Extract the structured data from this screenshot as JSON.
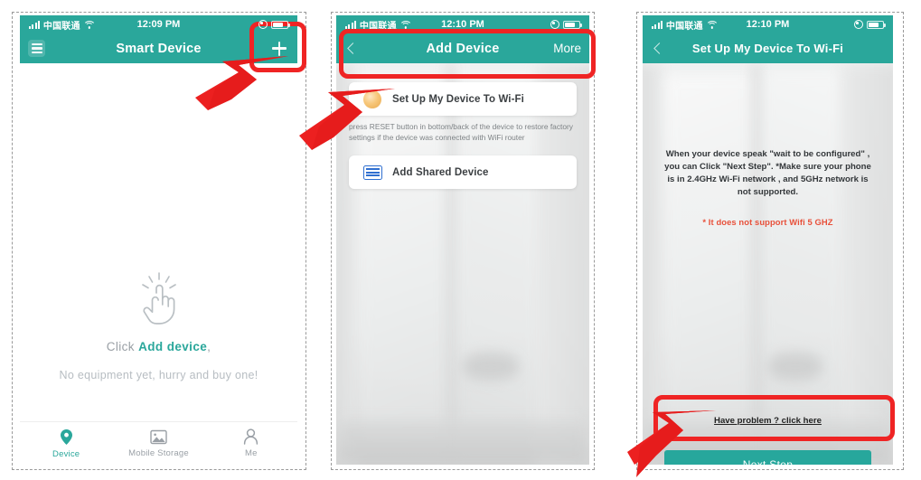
{
  "theme": {
    "teal": "#2aa79b",
    "teal_button": "#27a79c",
    "red_annotation": "#ef2424",
    "warn_red": "#e8503a",
    "muted_text": "#9aa0a6"
  },
  "screens": [
    {
      "id": "smart-device-list",
      "status_bar": {
        "carrier": "中国联通",
        "time": "12:09 PM",
        "signal_icon": "signal-bars-icon",
        "wifi_icon": "wifi-icon",
        "battery_icon": "battery-icon",
        "location_icon": "location-icon"
      },
      "nav": {
        "menu_icon": "hamburger-menu-icon",
        "title": "Smart Device",
        "add_icon": "plus-icon"
      },
      "empty_state": {
        "hand_icon": "tap-hand-icon",
        "title_prefix": "Click ",
        "title_highlight": "Add device",
        "title_suffix": ",",
        "subtitle": "No equipment yet, hurry and buy one!"
      },
      "tabbar": [
        {
          "label": "Device",
          "icon": "location-pin-icon",
          "active": true
        },
        {
          "label": "Mobile Storage",
          "icon": "photo-icon",
          "active": false
        },
        {
          "label": "Me",
          "icon": "person-icon",
          "active": false
        }
      ]
    },
    {
      "id": "add-device",
      "status_bar": {
        "carrier": "中国联通",
        "time": "12:10 PM",
        "signal_icon": "signal-bars-icon",
        "wifi_icon": "wifi-icon",
        "battery_icon": "battery-icon",
        "location_icon": "location-icon"
      },
      "nav": {
        "back_icon": "chevron-left-icon",
        "title": "Add Device",
        "more_label": "More"
      },
      "options": [
        {
          "label": "Set Up My Device To Wi-Fi",
          "icon": "sun-ripple-icon"
        },
        {
          "label": "Add Shared Device",
          "icon": "qr-code-icon"
        }
      ],
      "hint": "press RESET button in bottom/back of the device to restore factory settings if the device was connected with WiFi router"
    },
    {
      "id": "setup-wifi",
      "status_bar": {
        "carrier": "中国联通",
        "time": "12:10 PM",
        "signal_icon": "signal-bars-icon",
        "wifi_icon": "wifi-icon",
        "battery_icon": "battery-icon",
        "location_icon": "location-icon"
      },
      "nav": {
        "back_icon": "chevron-left-icon",
        "title": "Set Up My Device To Wi-Fi"
      },
      "instructions": "When your device speak \"wait to be configured\" , you can Click \"Next Step\". *Make sure your phone is in 2.4GHz Wi-Fi network , and 5GHz network is not supported.",
      "warning": "* It does not support Wifi 5 GHZ",
      "help_link": "Have problem ? click here",
      "primary_button": "Next Step"
    }
  ],
  "annotations": [
    {
      "name": "highlight-add-button",
      "shape": "red-rounded-box"
    },
    {
      "name": "highlight-setup-wifi-option",
      "shape": "red-rounded-box"
    },
    {
      "name": "highlight-next-step-button",
      "shape": "red-rounded-box"
    },
    {
      "name": "pointer-to-add-button",
      "shape": "red-arrow"
    },
    {
      "name": "pointer-to-setup-wifi-option",
      "shape": "red-arrow"
    },
    {
      "name": "pointer-to-next-step-button",
      "shape": "red-arrow"
    }
  ]
}
